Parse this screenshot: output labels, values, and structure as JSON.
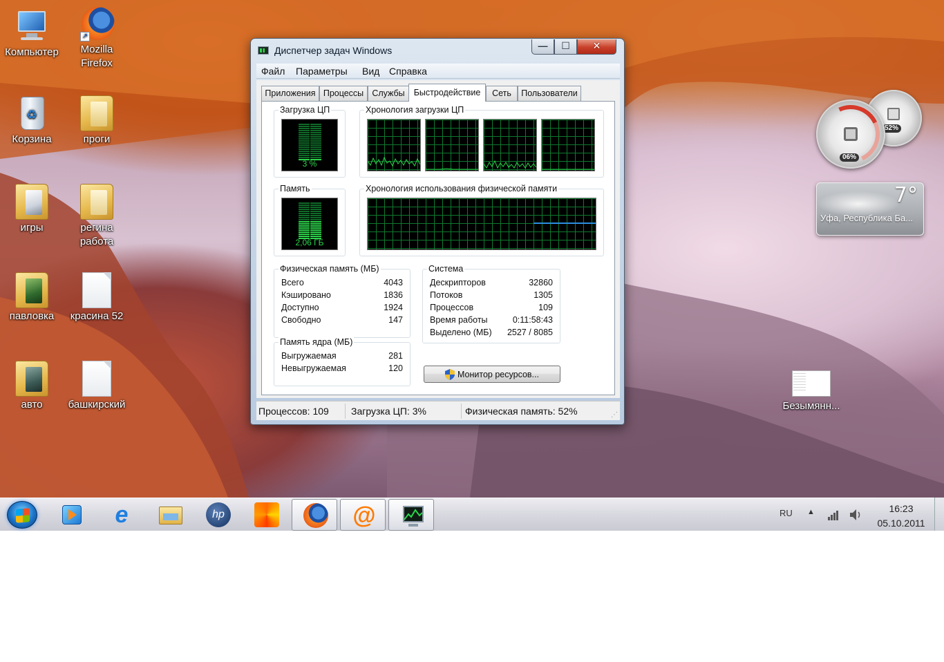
{
  "desktop": {
    "icons": [
      {
        "label": "Компьютер",
        "icon": "computer-icon"
      },
      {
        "label": "Mozilla Firefox",
        "icon": "firefox-icon"
      },
      {
        "label": "Корзина",
        "icon": "recycle-bin-icon"
      },
      {
        "label": "проги",
        "icon": "folder-icon"
      },
      {
        "label": "игры",
        "icon": "folder-icon"
      },
      {
        "label": "регина работа",
        "icon": "folder-icon"
      },
      {
        "label": "павловка",
        "icon": "folder-icon"
      },
      {
        "label": "красина 52",
        "icon": "document-icon"
      },
      {
        "label": "авто",
        "icon": "folder-icon"
      },
      {
        "label": "башкирский",
        "icon": "document-icon"
      },
      {
        "label": "Безымянн...",
        "icon": "image-file-icon"
      }
    ],
    "gadgets": {
      "cpu_meter": {
        "cpu": "06%",
        "ram": "52%",
        "cpu_level": 0.06,
        "ram_level": 0.52
      },
      "weather": {
        "temperature": "7°",
        "location": "Уфа, Республика Ба..."
      }
    }
  },
  "window": {
    "title": "Диспетчер задач Windows",
    "caption_buttons": {
      "minimize": "—",
      "maximize": "☐",
      "close": "✕"
    },
    "menu": [
      "Файл",
      "Параметры",
      "Вид",
      "Справка"
    ],
    "tabs": [
      "Приложения",
      "Процессы",
      "Службы",
      "Быстродействие",
      "Сеть",
      "Пользователи"
    ],
    "active_tab": "Быстродействие",
    "performance": {
      "cpu_usage": {
        "title": "Загрузка ЦП",
        "value": "3 %",
        "level": 0.03
      },
      "cpu_history": {
        "title": "Хронология загрузки ЦП",
        "cores": 4
      },
      "memory": {
        "title": "Память",
        "value": "2,06 ГБ",
        "level": 0.52
      },
      "memory_history": {
        "title": "Хронология использования физической памяти",
        "level": 0.52
      },
      "physical_memory": {
        "title": "Физическая память (МБ)",
        "rows": [
          {
            "label": "Всего",
            "value": "4043"
          },
          {
            "label": "Кэшировано",
            "value": "1836"
          },
          {
            "label": "Доступно",
            "value": "1924"
          },
          {
            "label": "Свободно",
            "value": "147"
          }
        ]
      },
      "kernel_memory": {
        "title": "Память ядра (МБ)",
        "rows": [
          {
            "label": "Выгружаемая",
            "value": "281"
          },
          {
            "label": "Невыгружаемая",
            "value": "120"
          }
        ]
      },
      "system": {
        "title": "Система",
        "rows": [
          {
            "label": "Дескрипторов",
            "value": "32860"
          },
          {
            "label": "Потоков",
            "value": "1305"
          },
          {
            "label": "Процессов",
            "value": "109"
          },
          {
            "label": "Время работы",
            "value": "0:11:58:43"
          },
          {
            "label": "Выделено (МБ)",
            "value": "2527 / 8085"
          }
        ]
      },
      "resource_monitor_button": "Монитор ресурсов..."
    },
    "statusbar": {
      "processes": "Процессов: 109",
      "cpu": "Загрузка ЦП: 3%",
      "memory": "Физическая память: 52%"
    }
  },
  "taskbar": {
    "pinned": [
      {
        "name": "media-player-icon",
        "open": false
      },
      {
        "name": "internet-explorer-icon",
        "open": false
      },
      {
        "name": "explorer-icon",
        "open": false
      },
      {
        "name": "hp-icon",
        "open": false
      },
      {
        "name": "photo-app-icon",
        "open": false
      },
      {
        "name": "firefox-icon",
        "open": true
      },
      {
        "name": "mail-agent-icon",
        "open": true
      },
      {
        "name": "task-manager-icon",
        "open": true
      }
    ],
    "tray": {
      "language": "RU",
      "time": "16:23",
      "date": "05.10.2011"
    }
  }
}
